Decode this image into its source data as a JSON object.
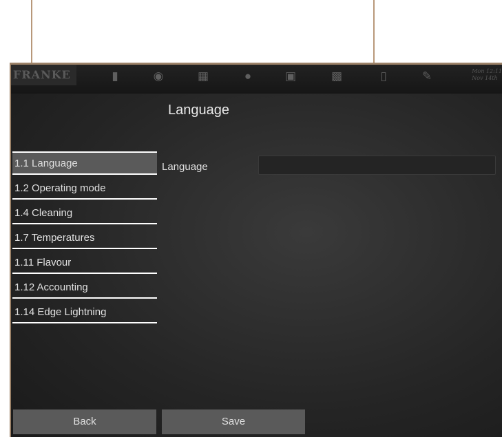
{
  "header": {
    "logo": "FRANKE",
    "datetime_line1": "Mon 12:11",
    "datetime_line2": "Nov 14th"
  },
  "toolbar_icons": [
    "beverage-icon",
    "coffee-bean-icon",
    "chocolate-icon",
    "water-drop-icon",
    "cups-icon",
    "cleaning-icon",
    "book-icon",
    "wrench-icon"
  ],
  "page": {
    "title": "Language"
  },
  "menu": [
    {
      "label": "1.1 Language",
      "active": true
    },
    {
      "label": "1.2 Operating mode"
    },
    {
      "label": "1.4 Cleaning"
    },
    {
      "label": "1.7 Temperatures"
    },
    {
      "label": "1.11 Flavour"
    },
    {
      "label": "1.12 Accounting"
    },
    {
      "label": "1.14 Edge Lightning"
    }
  ],
  "form": {
    "language_label": "Language",
    "language_value": ""
  },
  "buttons": {
    "back": "Back",
    "save": "Save"
  }
}
